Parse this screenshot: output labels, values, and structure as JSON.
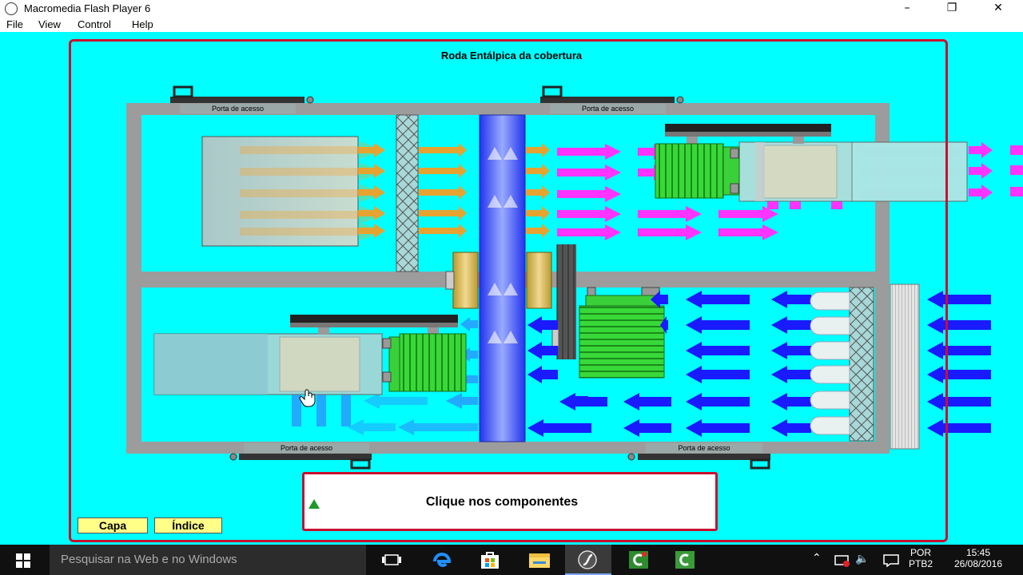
{
  "window": {
    "title": "Macromedia Flash Player 6",
    "controls": {
      "minimize": "–",
      "maximize": "❐",
      "close": "✕"
    }
  },
  "menu": [
    "File",
    "View",
    "Control",
    "Help"
  ],
  "stage": {
    "title": "Roda Entálpica da cobertura",
    "door_labels": [
      "Porta de acesso",
      "Porta de acesso",
      "Porta de acesso",
      "Porta de acesso"
    ],
    "message": "Clique nos componentes",
    "nav_buttons": [
      "Capa",
      "Índice"
    ]
  },
  "taskbar": {
    "search_placeholder": "Pesquisar na Web e no Windows",
    "apps": [
      "task-view-icon",
      "edge-icon",
      "store-icon",
      "file-explorer-icon",
      "flash-player-icon",
      "camtasia-recorder-icon",
      "camtasia-studio-icon"
    ],
    "language": [
      "POR",
      "PTB2"
    ],
    "time": "15:45",
    "date": "26/08/2016"
  },
  "colors": {
    "stage_bg": "#00ffff",
    "frame_border": "#c8102e",
    "housing": "#9c9c9c",
    "wheel": "#2a3cff",
    "supply_arrow": "#ff33ff",
    "exhaust_arrow": "#1a1aff",
    "orange_arrow": "#ff9a1a",
    "motor": "#2ad12a",
    "button_bg": "#ffff88"
  }
}
